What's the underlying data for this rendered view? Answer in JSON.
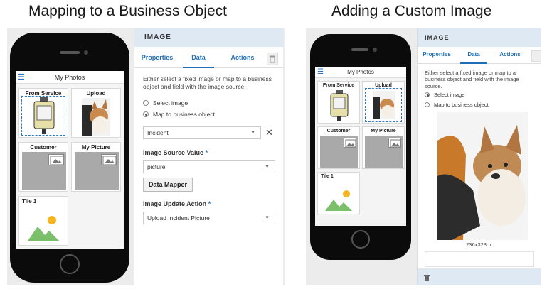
{
  "headings": {
    "left": "Mapping to a Business Object",
    "right": "Adding a Custom Image"
  },
  "left_phone": {
    "app_title": "My Photos",
    "tiles": {
      "from_service": "From Service",
      "upload": "Upload",
      "customer": "Customer",
      "my_picture": "My Picture",
      "tile1": "Tile 1"
    }
  },
  "left_panel": {
    "title": "IMAGE",
    "tabs": [
      "Properties",
      "Data",
      "Actions"
    ],
    "active_tab": "Data",
    "description": "Either select a fixed image or map to a business object and field with the image source.",
    "radio_options": [
      "Select image",
      "Map to business object"
    ],
    "selected_radio": "Map to business object",
    "object_select": "Incident",
    "source_label": "Image Source Value",
    "source_value": "picture",
    "mapper_button": "Data Mapper",
    "update_label": "Image Update Action",
    "update_value": "Upload Incident Picture",
    "required_mark": "*"
  },
  "right_phone": {
    "app_title": "My Photos",
    "tiles": {
      "from_service": "From Service",
      "upload": "Upload",
      "customer": "Customer",
      "my_picture": "My Picture",
      "tile1": "Tile 1"
    }
  },
  "right_panel": {
    "title": "IMAGE",
    "tabs": [
      "Properties",
      "Data",
      "Actions"
    ],
    "active_tab": "Data",
    "description": "Either select a fixed image or map to a business object and field with the image source.",
    "radio_options": [
      "Select image",
      "Map to business object"
    ],
    "selected_radio": "Select image",
    "image_size": "236x328px"
  },
  "colors": {
    "accent": "#1f6fb8",
    "panel_header": "#dfe9f3",
    "placeholder": "#a9a9a9",
    "sun": "#f5b622",
    "mountain": "#7bbf6a"
  },
  "icons": [
    "menu-icon",
    "image-placeholder-icon",
    "landscape-icon",
    "clear-icon",
    "dropdown-icon",
    "delete-icon"
  ]
}
